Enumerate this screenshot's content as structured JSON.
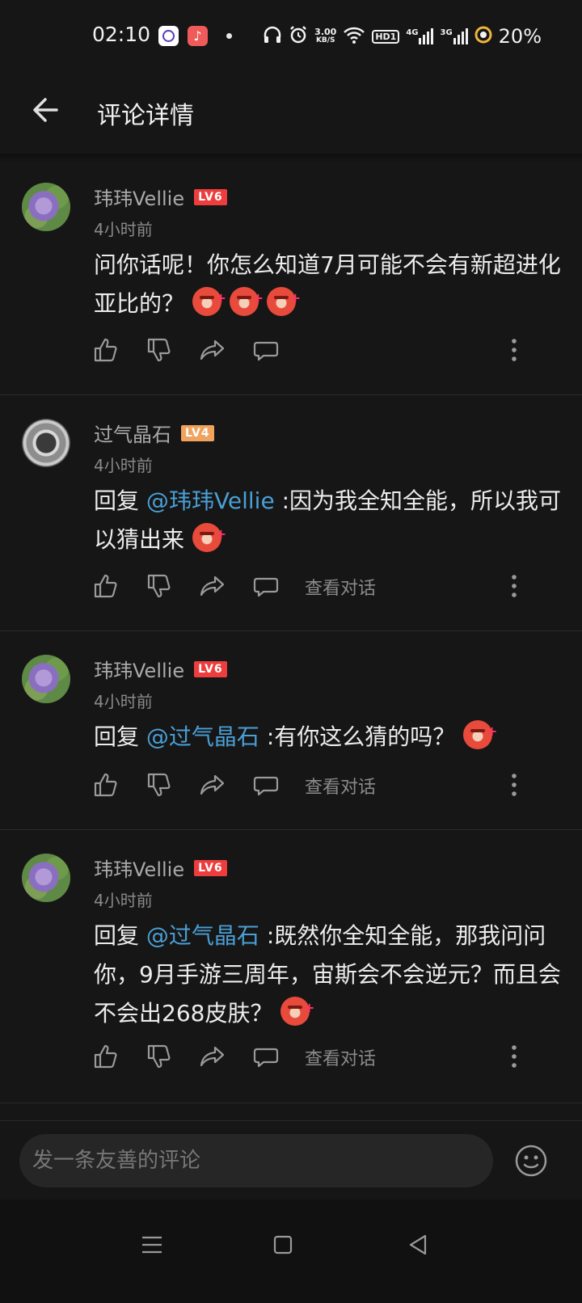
{
  "status_bar": {
    "time": "02:10",
    "net_speed_value": "3.00",
    "net_speed_unit": "KB/S",
    "hd_label": "HD1",
    "sig1_label": "4G",
    "sig2_label": "3G",
    "battery": "20%"
  },
  "header": {
    "title": "评论详情"
  },
  "comments": [
    {
      "username": "玮玮Vellie",
      "level": "LV6",
      "time": "4小时前",
      "text": "问你话呢！你怎么知道7月可能不会有新超进化亚比的？",
      "emoji_count": 3,
      "show_view_conversation": false
    },
    {
      "username": "过气晶石",
      "level": "LV4",
      "time": "4小时前",
      "reply_prefix": "回复 ",
      "mention": "@玮玮Vellie",
      "text": " :因为我全知全能，所以我可以猜出来",
      "emoji_count": 1,
      "show_view_conversation": true
    },
    {
      "username": "玮玮Vellie",
      "level": "LV6",
      "time": "4小时前",
      "reply_prefix": "回复 ",
      "mention": "@过气晶石",
      "text": " :有你这么猜的吗？",
      "emoji_count": 1,
      "show_view_conversation": true
    },
    {
      "username": "玮玮Vellie",
      "level": "LV6",
      "time": "4小时前",
      "reply_prefix": "回复 ",
      "mention": "@过气晶石",
      "text": " :既然你全知全能，那我问问你，9月手游三周年，宙斯会不会逆元？而且会不会出268皮肤？",
      "emoji_count": 1,
      "show_view_conversation": true
    }
  ],
  "actions": {
    "view_conversation": "查看对话"
  },
  "composer": {
    "placeholder": "发一条友善的评论"
  },
  "colors": {
    "background": "#161616",
    "mention": "#4a9fd5",
    "level6": "#ee3d3d",
    "level4": "#f0a35e"
  }
}
